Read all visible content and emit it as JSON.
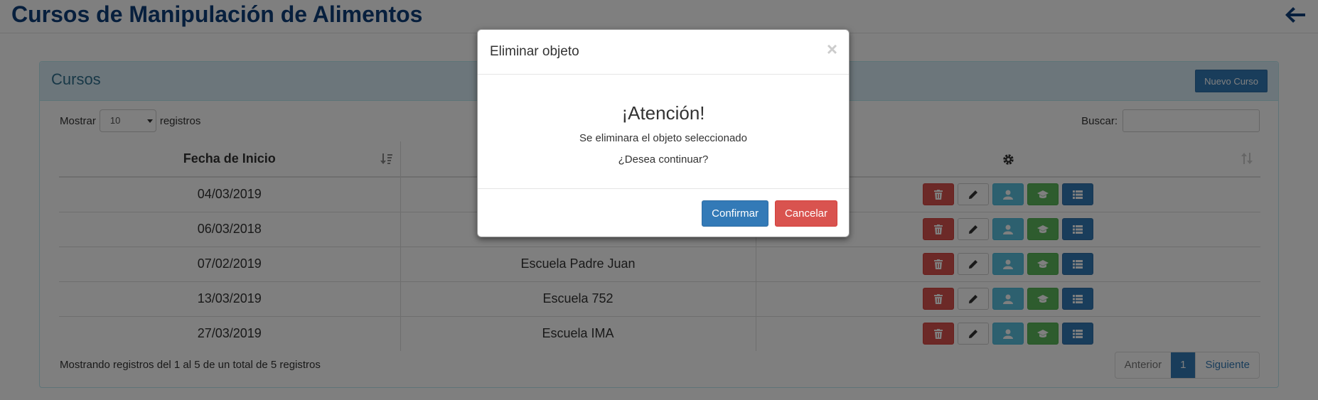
{
  "header": {
    "title": "Cursos de Manipulación de Alimentos",
    "back_icon": "arrow-left-icon"
  },
  "panel": {
    "title": "Cursos",
    "new_button": "Nuevo Curso",
    "length_label_pre": "Mostrar",
    "length_value": "10",
    "length_label_post": "registros",
    "search_label": "Buscar:",
    "search_value": ""
  },
  "table": {
    "columns": [
      "Fecha de Inicio",
      "",
      ""
    ],
    "actions_icon": "gear-icon",
    "rows": [
      {
        "fecha": "04/03/2019",
        "escuela": ""
      },
      {
        "fecha": "06/03/2018",
        "escuela": ""
      },
      {
        "fecha": "07/02/2019",
        "escuela": "Escuela Padre Juan"
      },
      {
        "fecha": "13/03/2019",
        "escuela": "Escuela 752"
      },
      {
        "fecha": "27/03/2019",
        "escuela": "Escuela IMA"
      }
    ],
    "action_icons": [
      "trash-icon",
      "pencil-icon",
      "user-icon",
      "graduation-cap-icon",
      "list-icon"
    ]
  },
  "footer": {
    "info": "Mostrando registros del 1 al 5 de un total de 5 registros",
    "prev": "Anterior",
    "page": "1",
    "next": "Siguiente"
  },
  "modal": {
    "title": "Eliminar objeto",
    "close": "×",
    "heading": "¡Atención!",
    "text": "Se eliminara el objeto seleccionado",
    "question": "¿Desea continuar?",
    "confirm": "Confirmar",
    "cancel": "Cancelar"
  },
  "colors": {
    "primary": "#337ab7",
    "danger": "#d9534f",
    "info": "#5bc0de",
    "success": "#5cb85c",
    "title": "#0e3f7a"
  }
}
